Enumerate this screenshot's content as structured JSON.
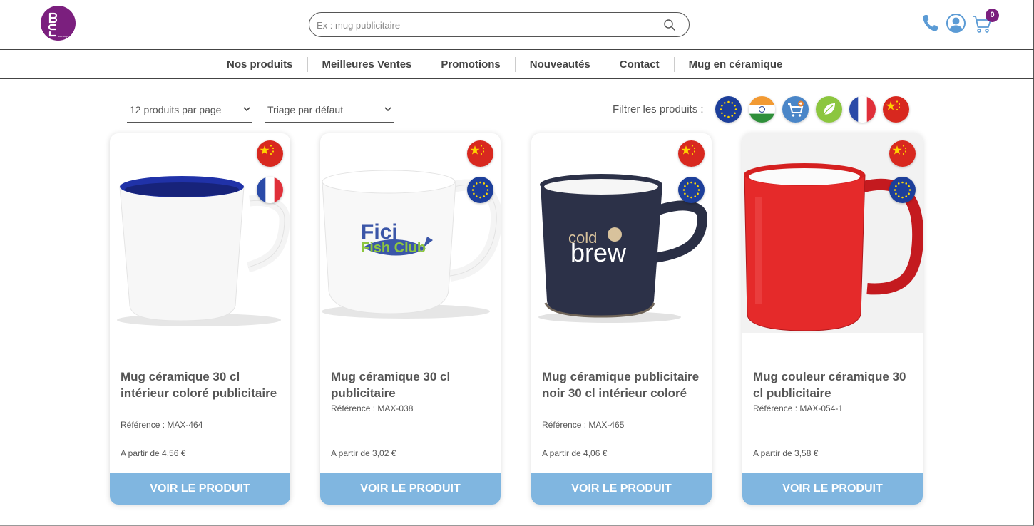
{
  "header": {
    "logo_text": "BCL",
    "search_placeholder": "Ex : mug publicitaire",
    "cart_count": "0"
  },
  "nav": {
    "items": [
      "Nos produits",
      "Meilleures Ventes",
      "Promotions",
      "Nouveautés",
      "Contact",
      "Mug en céramique"
    ]
  },
  "toolbar": {
    "per_page": "12 produits par page",
    "sort": "Triage par défaut",
    "filter_label": "Filtrer les produits :",
    "filters": [
      "eu-flag-icon",
      "india-flag-icon",
      "cart-plus-icon",
      "leaf-icon",
      "france-flag-icon",
      "china-flag-icon"
    ]
  },
  "colors": {
    "brand": "#7b1f7e",
    "accent_button": "#80b6e0",
    "icon_blue": "#5b9bd5"
  },
  "products": [
    {
      "title": "Mug céramique 30 cl intérieur coloré publicitaire",
      "reference": "Référence : MAX-464",
      "price": "A partir de 4,56 €",
      "button": "VOIR LE PRODUIT",
      "flags": [
        "china-flag-icon",
        "france-flag-icon"
      ]
    },
    {
      "title": "Mug céramique 30 cl publicitaire",
      "reference": "Référence : MAX-038",
      "price": "A partir de 3,02 €",
      "button": "VOIR LE PRODUIT",
      "flags": [
        "china-flag-icon",
        "eu-flag-icon"
      ],
      "print_line1": "Fici",
      "print_line2": "Fish Club"
    },
    {
      "title": "Mug céramique publicitaire noir 30 cl intérieur coloré",
      "reference": "Référence : MAX-465",
      "price": "A partir de 4,06 €",
      "button": "VOIR LE PRODUIT",
      "flags": [
        "china-flag-icon",
        "eu-flag-icon"
      ],
      "print_line1": "cold",
      "print_line2": "brew"
    },
    {
      "title": "Mug couleur céramique 30 cl publicitaire",
      "reference": "Référence : MAX-054-1",
      "price": "A partir de 3,58 €",
      "button": "VOIR LE PRODUIT",
      "flags": [
        "china-flag-icon",
        "eu-flag-icon"
      ]
    }
  ]
}
